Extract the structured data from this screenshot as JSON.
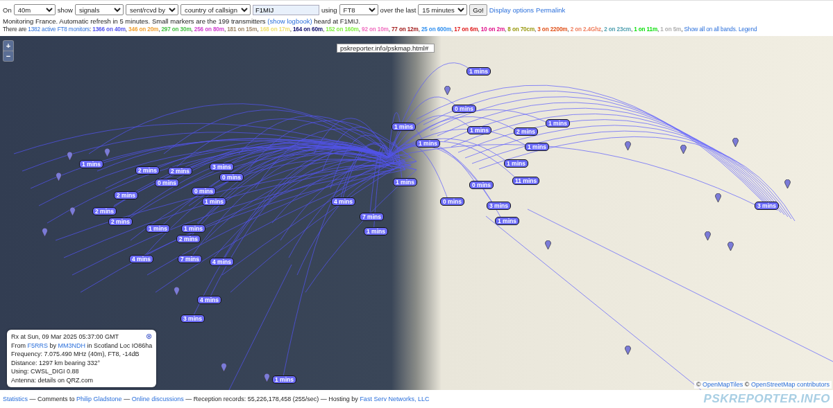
{
  "controls": {
    "band_label": "On",
    "band": "40m",
    "show_label": "show",
    "show": "signals",
    "direction": "sent/rcvd by",
    "scope": "country of callsign",
    "callsign": "F1MIJ",
    "using_label": "using",
    "mode": "FT8",
    "period_label": "over the last",
    "period": "15 minutes",
    "go": "Go!",
    "links": [
      "Display options",
      "Permalink"
    ]
  },
  "status": {
    "before": "Monitoring France. Automatic refresh in 5 minutes. Small markers are the 199 transmitters",
    "link": "(show logbook)",
    "after": "heard at F1MIJ."
  },
  "monitors": {
    "before": "There are",
    "link": "1382 active FT8 monitors",
    "colon": ":",
    "separator": ",",
    "bands": [
      {
        "text": "1366 on 40m",
        "color": "#5555ee"
      },
      {
        "text": "346 on 20m",
        "color": "#f0a030"
      },
      {
        "text": "297 on 30m",
        "color": "#44c044"
      },
      {
        "text": "256 on 80m",
        "color": "#d040d0"
      },
      {
        "text": "181 on 15m",
        "color": "#a08868"
      },
      {
        "text": "168 on 17m",
        "color": "#f0e070"
      },
      {
        "text": "164 on 60m",
        "color": "#101070"
      },
      {
        "text": "152 on 160m",
        "color": "#80f040"
      },
      {
        "text": "92 on 10m",
        "color": "#f070c0"
      },
      {
        "text": "77 on 12m",
        "color": "#a01818"
      },
      {
        "text": "25 on 600m",
        "color": "#3090f0"
      },
      {
        "text": "17 on 6m",
        "color": "#e01818"
      },
      {
        "text": "10 on 2m",
        "color": "#e0108a"
      },
      {
        "text": "8 on 70cm",
        "color": "#999910"
      },
      {
        "text": "3 on 2200m",
        "color": "#e05018"
      },
      {
        "text": "2 on 2.4Ghz",
        "color": "#f08060"
      },
      {
        "text": "2 on 23cm",
        "color": "#50a0b0"
      },
      {
        "text": "1 on 11m",
        "color": "#10e010"
      },
      {
        "text": "1 on 5m",
        "color": "#b0b0b0"
      }
    ],
    "links": [
      "Show all on all bands.",
      "Legend"
    ]
  },
  "map": {
    "zoom_in": "+",
    "zoom_out": "−",
    "url": "pskreporter.info/pskmap.html#",
    "attribution": {
      "symbol": "©",
      "links": [
        "OpenMapTiles",
        "OpenStreetMap contributors"
      ]
    },
    "markers": [
      {
        "label": "1 mins"
      },
      {
        "label": "1 mins"
      },
      {
        "label": "2 mins"
      },
      {
        "label": "2 mins"
      },
      {
        "label": "3 mins"
      },
      {
        "label": "0 mins"
      },
      {
        "label": "0 mins"
      },
      {
        "label": "0 mins"
      },
      {
        "label": "2 mins"
      },
      {
        "label": "1 mins"
      },
      {
        "label": "2 mins"
      },
      {
        "label": "2 mins"
      },
      {
        "label": "1 mins"
      },
      {
        "label": "1 mins"
      },
      {
        "label": "2 mins"
      },
      {
        "label": "4 mins"
      },
      {
        "label": "7 mins"
      },
      {
        "label": "1 mins"
      },
      {
        "label": "4 mins"
      },
      {
        "label": "7 mins"
      },
      {
        "label": "4 mins"
      },
      {
        "label": "4 mins"
      },
      {
        "label": "3 mins"
      },
      {
        "label": "1 mins"
      },
      {
        "label": "1 mins"
      },
      {
        "label": "11 mins"
      },
      {
        "label": "3 mins"
      },
      {
        "label": "3 mins"
      },
      {
        "label": "1 mins"
      },
      {
        "label": "1 mins"
      },
      {
        "label": "1 mins"
      },
      {
        "label": "0 mins"
      },
      {
        "label": "2 mins"
      },
      {
        "label": "1 mins"
      },
      {
        "label": "1 mins"
      },
      {
        "label": "0 mins"
      },
      {
        "label": "1 mins"
      },
      {
        "label": "1 mins"
      },
      {
        "label": "0 mins"
      }
    ],
    "popup": {
      "close": "⊗",
      "title": "Rx at Sun, 09 Mar 2025 05:37:00 GMT",
      "from": "From",
      "sender": "F5RRS",
      "by": "by",
      "receiver": "MM3NDH",
      "location": "in Scotland Loc IO86ha",
      "lines": [
        "Frequency: 7.075.490 MHz (40m), FT8, -14dB",
        "Distance: 1297 km bearing 332°",
        "Using: CWSL_DIGI 0.88",
        "Antenna: details on QRZ.com"
      ]
    }
  },
  "footer": {
    "parts": [
      {
        "kind": "link",
        "text": "Statistics"
      },
      {
        "kind": "text",
        "text": "— Comments to"
      },
      {
        "kind": "link",
        "text": "Philip Gladstone"
      },
      {
        "kind": "text",
        "text": "—"
      },
      {
        "kind": "link",
        "text": "Online discussions"
      },
      {
        "kind": "text",
        "text": "— Reception records: 55,226,178,458 (255/sec) — Hosting by"
      },
      {
        "kind": "link",
        "text": "Fast Serv Networks, LLC"
      }
    ],
    "logo": "PSKREPORTER.INFO"
  }
}
